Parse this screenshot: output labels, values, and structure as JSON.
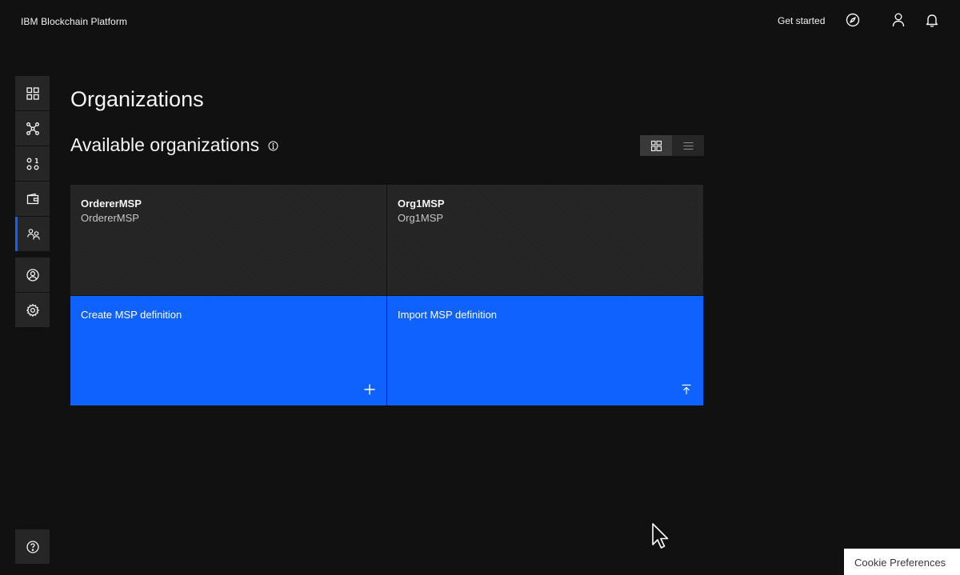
{
  "header": {
    "brand": "IBM Blockchain Platform",
    "get_started": "Get started",
    "icons": [
      "compass-icon",
      "user-icon",
      "notification-icon"
    ]
  },
  "leftnav": {
    "items": [
      {
        "name": "nodes",
        "icon": "dashboard-grid-icon"
      },
      {
        "name": "channels",
        "icon": "network-icon"
      },
      {
        "name": "smart-contracts",
        "icon": "smart-contracts-icon"
      },
      {
        "name": "wallet",
        "icon": "wallet-icon"
      },
      {
        "name": "organizations",
        "icon": "organizations-icon",
        "active": true
      },
      {
        "name": "users",
        "icon": "user-avatar-icon"
      },
      {
        "name": "settings",
        "icon": "settings-icon"
      }
    ],
    "help_icon": "help-icon",
    "active_color": "#0f62fe"
  },
  "main": {
    "title": "Organizations",
    "section_title": "Available organizations",
    "view_toggle": {
      "selected": "tile",
      "options": [
        "tile-view-icon",
        "list-view-icon"
      ]
    },
    "organizations": [
      {
        "title": "OrdererMSP",
        "subtitle": "OrdererMSP"
      },
      {
        "title": "Org1MSP",
        "subtitle": "Org1MSP"
      }
    ],
    "actions": [
      {
        "label": "Create MSP definition",
        "icon": "add-icon"
      },
      {
        "label": "Import MSP definition",
        "icon": "upload-icon"
      }
    ]
  },
  "cookie": {
    "label": "Cookie Preferences"
  },
  "colors": {
    "background": "#111111",
    "surface": "#262626",
    "primary": "#0f62fe",
    "text": "#f4f4f4"
  }
}
